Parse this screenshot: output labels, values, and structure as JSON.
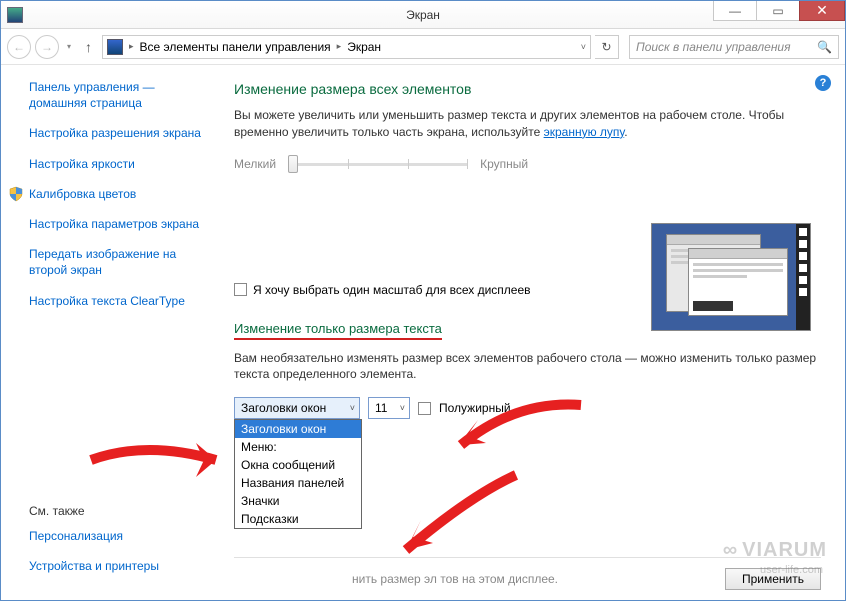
{
  "window": {
    "title": "Экран"
  },
  "breadcrumb": {
    "item1": "Все элементы панели управления",
    "item2": "Экран"
  },
  "search": {
    "placeholder": "Поиск в панели управления"
  },
  "sidebar": {
    "home": "Панель управления — домашняя страница",
    "items": [
      "Настройка разрешения экрана",
      "Настройка яркости",
      "Калибровка цветов",
      "Настройка параметров экрана",
      "Передать изображение на второй экран",
      "Настройка текста ClearType"
    ],
    "see_also_header": "См. также",
    "see_also": [
      "Персонализация",
      "Устройства и принтеры"
    ]
  },
  "main": {
    "heading1": "Изменение размера всех элементов",
    "intro_part1": "Вы можете увеличить или уменьшить размер текста и других элементов на рабочем столе. Чтобы временно увеличить только часть экрана, используйте ",
    "intro_link": "экранную лупу",
    "intro_part2": ".",
    "slider_min": "Мелкий",
    "slider_max": "Крупный",
    "checkbox1": "Я хочу выбрать один масштаб для всех дисплеев",
    "heading2": "Изменение только размера текста",
    "body2": "Вам необязательно изменять размер всех элементов рабочего стола — можно изменить только размер текста определенного элемента.",
    "element_combo": {
      "selected": "Заголовки окон",
      "options": [
        "Заголовки окон",
        "Меню:",
        "Окна сообщений",
        "Названия панелей",
        "Значки",
        "Подсказки"
      ]
    },
    "size_combo": {
      "selected": "11"
    },
    "bold_label": "Полужирный",
    "footer_text": "нить размер эл         тов на этом дисплее.",
    "apply": "Применить"
  },
  "watermark": "VIARUM",
  "watermark2": "user-life.com"
}
